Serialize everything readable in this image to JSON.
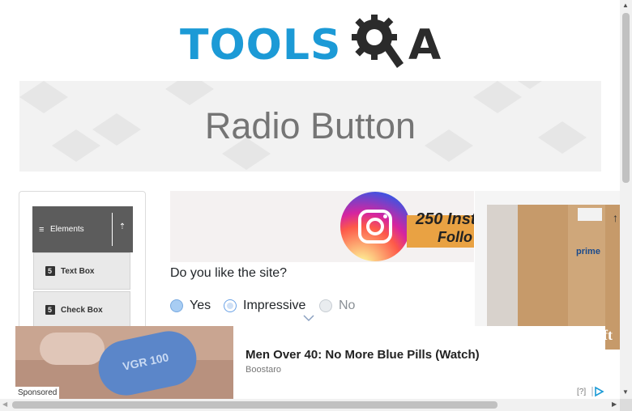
{
  "logo": {
    "text_left": "TOOLS",
    "text_right": "A",
    "gear_letter": "Q"
  },
  "banner": {
    "title": "Radio Button"
  },
  "sidebar": {
    "group_label": "Elements",
    "items": [
      {
        "label": "Text Box",
        "icon": "html5-icon"
      },
      {
        "label": "Check Box",
        "icon": "html5-icon"
      }
    ]
  },
  "instagram_ad": {
    "line1": "250 Inst",
    "line2": "Follo"
  },
  "form": {
    "question": "Do you like the site?",
    "options": [
      {
        "label": "Yes",
        "state": "enabled"
      },
      {
        "label": "Impressive",
        "state": "enabled"
      },
      {
        "label": "No",
        "state": "disabled"
      }
    ]
  },
  "right_ad": {
    "box_label": "prime",
    "close_symbol": "↑",
    "overlay_text": "eft"
  },
  "bottom_ad": {
    "headline": "Men Over 40: No More Blue Pills (Watch)",
    "advertiser": "Boostaro",
    "sponsored_label": "Sponsored",
    "pill_text": "VGR 100",
    "help_label": "[?]"
  },
  "scrollbars": {
    "up": "▲",
    "down": "▼",
    "left": "◀",
    "right": "▶"
  },
  "colors": {
    "brand_blue": "#1c9ad6",
    "sidebar_header": "#5c5c5c",
    "banner_title": "#757575"
  }
}
